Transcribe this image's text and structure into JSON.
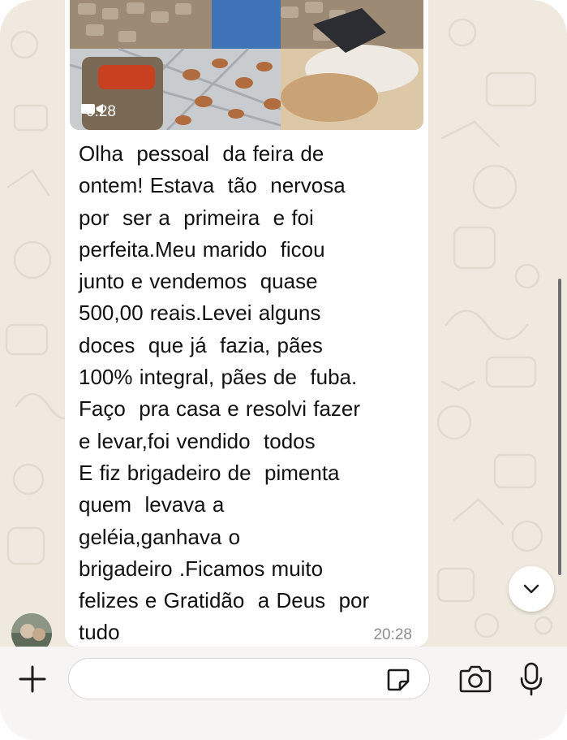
{
  "message": {
    "video_duration": "0:28",
    "text": "Olha  pessoal  da feira de\nontem! Estava  tão  nervosa\npor  ser a  primeira  e foi\nperfeita.Meu marido  ficou\njunto e vendemos  quase\n500,00 reais.Levei alguns\ndoces  que já  fazia, pães\n100% integral, pães de  fuba.\nFaço  pra casa e resolvi fazer\ne levar,foi vendido  todos\nE fiz brigadeiro de  pimenta\nquem  levava a\ngeléia,ganhava o\nbrigadeiro .Ficamos muito\nfelizes e Gratidão  a Deus  por\ntudo",
    "time": "20:28"
  },
  "composer": {
    "input_value": "",
    "input_placeholder": ""
  },
  "icons": {
    "add": "plus-icon",
    "sticker": "sticker-icon",
    "camera": "camera-icon",
    "mic": "microphone-icon",
    "scroll": "chevron-down-icon",
    "video": "video-camera-icon"
  },
  "colors": {
    "background": "#efe9df",
    "bubble": "#ffffff",
    "text": "#111111",
    "timestamp": "#8c8c8c"
  }
}
